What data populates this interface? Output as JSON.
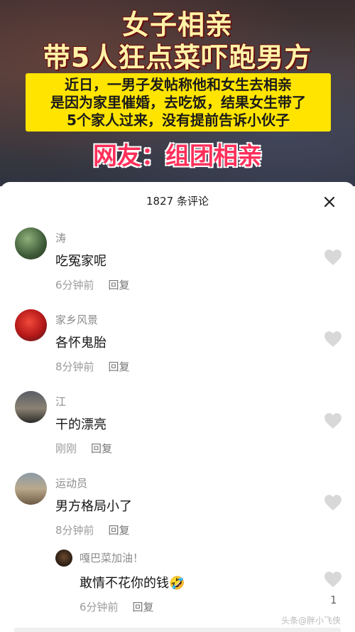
{
  "video": {
    "headline_line1": "女子相亲",
    "headline_line2": "带5人狂点菜吓跑男方",
    "summary_lines": [
      "近日，一男子发帖称他和女生去相亲",
      "是因为家里催婚，去吃饭，结果女生带了",
      "5个家人过来，没有提前告诉小伙子"
    ],
    "netizen_caption": "网友：组团相亲"
  },
  "comments_panel": {
    "title": "1827 条评论",
    "close_icon": "close-icon",
    "reply_label": "回复",
    "comments": [
      {
        "user": "涛",
        "text": "吃冤家呢",
        "time": "6分钟前"
      },
      {
        "user": "家乡风景",
        "text": "各怀鬼胎",
        "time": "8分钟前"
      },
      {
        "user": "江",
        "text": "干的漂亮",
        "time": "刚刚"
      },
      {
        "user": "运动员",
        "text": "男方格局小了",
        "time": "8分钟前"
      }
    ],
    "reply": {
      "user": "嘎巴菜加油！",
      "text": "敢情不花你的钱",
      "emoji": "🤣",
      "time": "6分钟前",
      "likes": "1"
    }
  },
  "watermark": "头条@胖小飞侠",
  "colors": {
    "highlight": "#ffe400",
    "caption_red": "#ff2f5a",
    "heart": "#d8d8d8"
  }
}
